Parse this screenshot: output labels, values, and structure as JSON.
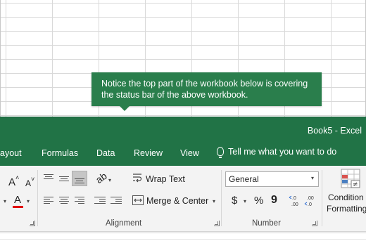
{
  "callout": {
    "line1": "Notice the top part of the workbook below is covering",
    "line2": "the status bar of the above workbook."
  },
  "window": {
    "title": "Book5  -  Excel"
  },
  "tabs": [
    {
      "label": "ayout"
    },
    {
      "label": "Formulas"
    },
    {
      "label": "Data"
    },
    {
      "label": "Review"
    },
    {
      "label": "View"
    }
  ],
  "tell_me": {
    "label": "Tell me what you want to do",
    "icon": "lightbulb-icon"
  },
  "ribbon": {
    "font_group": {
      "grow_font": "A",
      "shrink_font": "A",
      "font_color": "A",
      "font_color_value": "#e00000"
    },
    "alignment": {
      "wrap_text": "Wrap Text",
      "merge_center": "Merge & Center",
      "group_label": "Alignment"
    },
    "number": {
      "format_value": "General",
      "currency": "$",
      "percent": "%",
      "comma": "9",
      "increase_decimal": ".0→.00",
      "decrease_decimal": ".00→.0",
      "group_label": "Number"
    },
    "styles": {
      "conditional_formatting_line1": "Condition",
      "conditional_formatting_line2": "Formatting"
    }
  },
  "colors": {
    "excel_green": "#217346",
    "callout_green": "#2a7e4c",
    "ribbon_bg": "#f3f3f3"
  }
}
